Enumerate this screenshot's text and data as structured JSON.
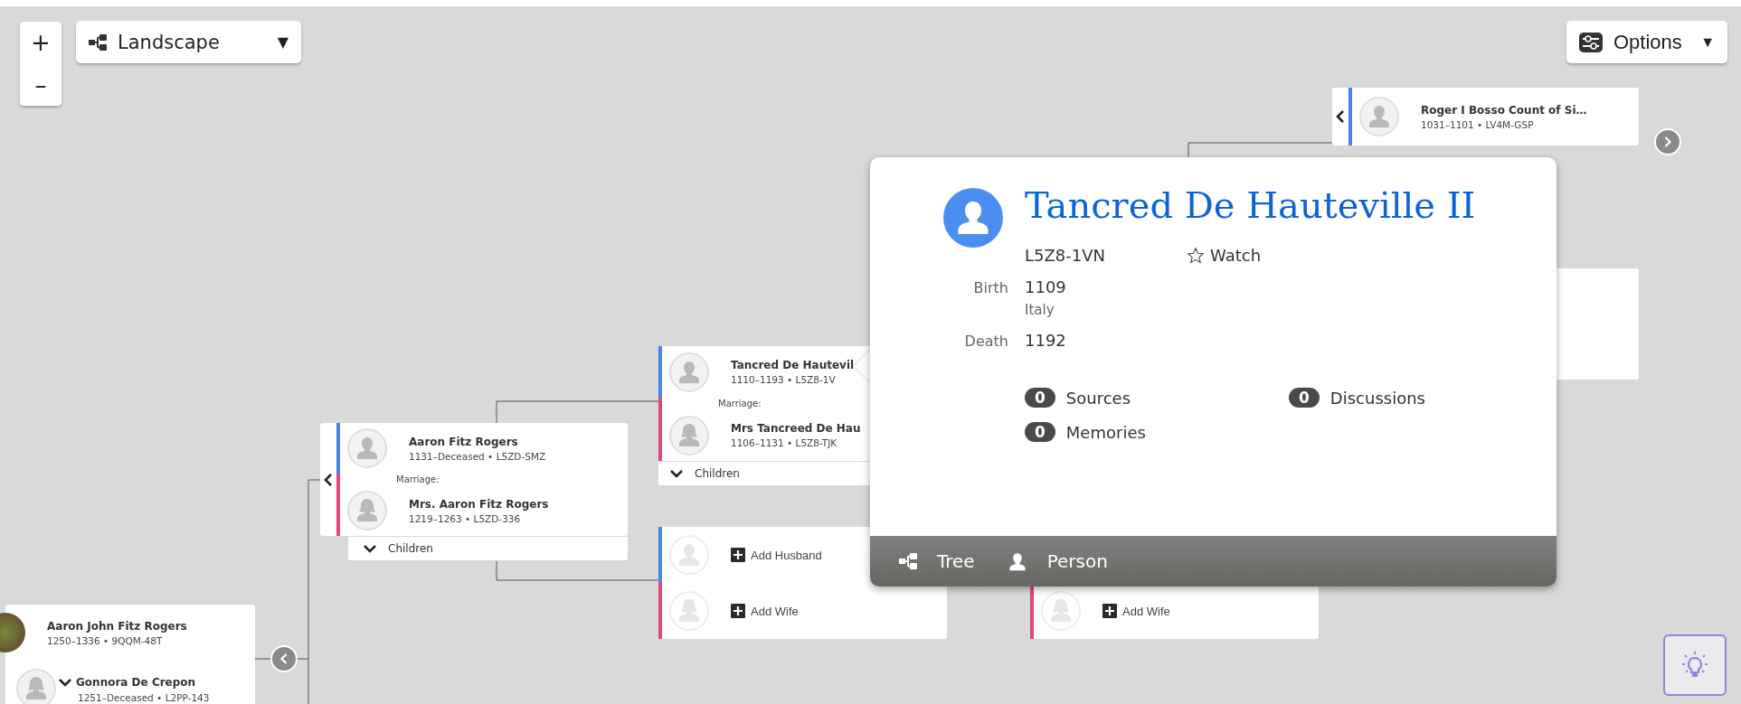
{
  "toolbar": {
    "zoom_in": "+",
    "zoom_out": "–",
    "view": {
      "label": "Landscape",
      "caret": "▼"
    },
    "options": {
      "label": "Options",
      "caret": "▼"
    }
  },
  "tree": {
    "couples": [
      {
        "parents_toggle": true,
        "nav": {
          "kind": "right"
        },
        "persons": [
          {
            "kind": "male",
            "name": "Roger I Bosso Count of Si…",
            "details": "1031–1101 • LV4M-GSP",
            "toggle": false
          }
        ]
      },
      {
        "parents_toggle": false,
        "marriage_label": "Marriage:",
        "children_label": "Children",
        "persons": [
          {
            "kind": "male",
            "name": "Tancred De Hautevil",
            "details": "1110–1193 • L5Z8-1V",
            "toggle": false
          },
          {
            "kind": "female",
            "name": "Mrs Tancreed De Hau",
            "details": "1106–1131 • L5Z8-TJK",
            "toggle": false
          }
        ]
      },
      {
        "parents_toggle": true,
        "marriage_label": "Marriage:",
        "children_label": "Children",
        "persons": [
          {
            "kind": "male",
            "name": "Aaron Fitz Rogers",
            "details": "1131–Deceased • L5ZD-SMZ",
            "toggle": false
          },
          {
            "kind": "female",
            "name": "Mrs. Aaron Fitz Rogers",
            "details": "1219–1263 • L5ZD-336",
            "toggle": false
          }
        ]
      },
      {
        "parents_toggle": false,
        "persons": [
          {
            "kind": "add_male",
            "name": "Add Husband"
          },
          {
            "kind": "add_female",
            "name": "Add Wife"
          }
        ]
      },
      {
        "parents_toggle": false,
        "persons": [
          {
            "kind": "add_female",
            "name": "Add Wife"
          }
        ]
      },
      {
        "parents_toggle": false,
        "nav": {
          "kind": "left"
        },
        "persons": [
          {
            "kind": "photo",
            "name": "Aaron John Fitz Rogers",
            "details": "1250–1336 • 9QQM-48T",
            "toggle": false
          },
          {
            "kind": "female_plain",
            "name": "Gonnora De Crepon",
            "details": "1251–Deceased • L2PP-143",
            "toggle": true
          }
        ]
      }
    ]
  },
  "person_popup": {
    "name": "Tancred De Hauteville II",
    "pid": "L5Z8-1VN",
    "watch": {
      "label": "Watch",
      "on": false
    },
    "facts": [
      {
        "label": "Birth",
        "value": "1109",
        "place": "Italy"
      },
      {
        "label": "Death",
        "value": "1192"
      }
    ],
    "counts": [
      {
        "count": "0",
        "label": "Sources"
      },
      {
        "count": "0",
        "label": "Discussions"
      },
      {
        "count": "0",
        "label": "Memories"
      }
    ],
    "footer": [
      {
        "kind": "tree",
        "label": "Tree"
      },
      {
        "kind": "person",
        "label": "Person"
      }
    ]
  }
}
